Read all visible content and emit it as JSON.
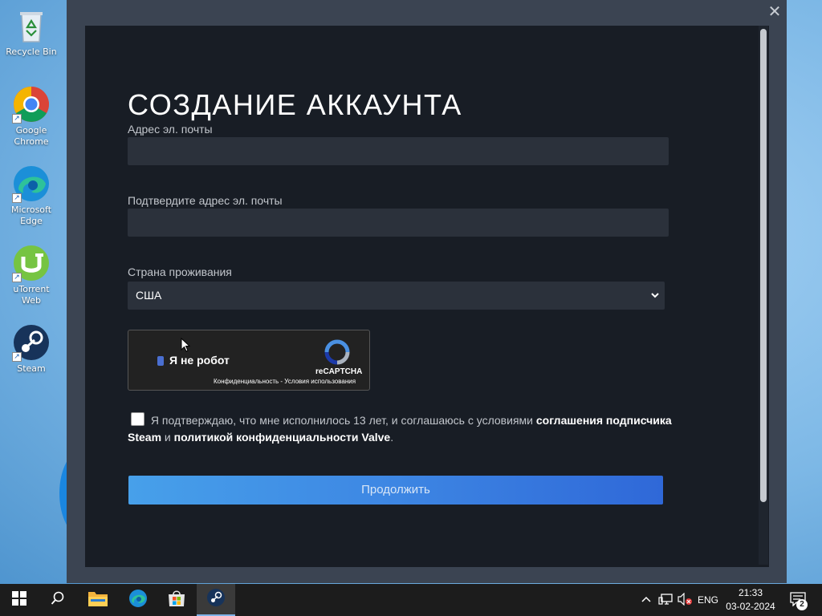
{
  "desktop": {
    "icons": [
      {
        "label": "Recycle Bin",
        "icon": "recycle-bin-icon"
      },
      {
        "label": "Google Chrome",
        "icon": "chrome-icon"
      },
      {
        "label": "Microsoft Edge",
        "icon": "edge-icon"
      },
      {
        "label": "uTorrent Web",
        "icon": "utorrent-icon"
      },
      {
        "label": "Steam",
        "icon": "steam-icon"
      }
    ]
  },
  "window": {
    "close_glyph": "✕"
  },
  "form": {
    "title": "СОЗДАНИЕ АККАУНТА",
    "email_label": "Адрес эл. почты",
    "email_value": "",
    "confirm_email_label": "Подтвердите адрес эл. почты",
    "confirm_email_value": "",
    "country_label": "Страна проживания",
    "country_value": "США",
    "recaptcha": {
      "label": "Я не робот",
      "brand": "reCAPTCHA",
      "privacy_link": "Конфиденциальность",
      "separator": " - ",
      "terms_link": "Условия использования"
    },
    "agreement": {
      "text_before": "Я подтверждаю, что мне исполнилось 13 лет, и соглашаюсь с условиями",
      "link_subscriber": "соглашения подписчика Steam",
      "text_middle": "и",
      "link_privacy": "политикой конфиденциальности Valve",
      "text_end": "."
    },
    "continue_label": "Продолжить"
  },
  "taskbar": {
    "apps": [
      "start-icon",
      "search-icon",
      "file-explorer-icon",
      "edge-icon",
      "microsoft-store-icon",
      "steam-icon"
    ],
    "active_app": "steam",
    "language": "ENG",
    "time": "21:33",
    "date": "03-02-2024",
    "notification_count": "2"
  },
  "colors": {
    "panel_bg": "#181d25",
    "input_bg": "#2b313b",
    "button_start": "#47a0ea",
    "button_end": "#2f68d8"
  }
}
